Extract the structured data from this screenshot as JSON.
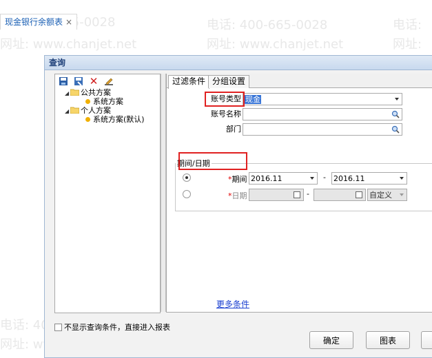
{
  "tab": {
    "label": "现金银行余额表",
    "close": "×"
  },
  "watermark": {
    "phone": "电话: 400-665-0028",
    "site": "网址: www.chanjet.net",
    "phone_short": "400-665-0028",
    "site_short": "www.chanjet.net",
    "prefix_phone": "电话:",
    "prefix_site": "网址:"
  },
  "dialog": {
    "title": "查询"
  },
  "toolbar": {
    "icons": [
      "save-icon",
      "saveas-icon",
      "delete-icon",
      "edit-icon"
    ],
    "delete_glyph": "✕"
  },
  "tree": {
    "public": {
      "label": "公共方案",
      "child": "系统方案"
    },
    "personal": {
      "label": "个人方案",
      "child": "系统方案(默认)"
    }
  },
  "right_tabs": {
    "filter": "过滤条件",
    "group": "分组设置"
  },
  "form": {
    "account_type_label": "账号类型",
    "account_type_value": "现金",
    "account_name_label": "账号名称",
    "department_label": "部门",
    "period_group_label": "期间/日期",
    "period_label": "期间",
    "period_from": "2016.11",
    "dash": "-",
    "period_to": "2016.11",
    "date_label": "日期",
    "date_dash": "-",
    "custom_label": "自定义",
    "required_mark": "*"
  },
  "more_conditions": "更多条件",
  "skip_checkbox": "不显示查询条件，直接进入报表",
  "buttons": {
    "ok": "确定",
    "chart": "图表"
  },
  "colors": {
    "link": "#1a3fd0",
    "highlight": "#e02020",
    "selection": "#3875d7"
  }
}
